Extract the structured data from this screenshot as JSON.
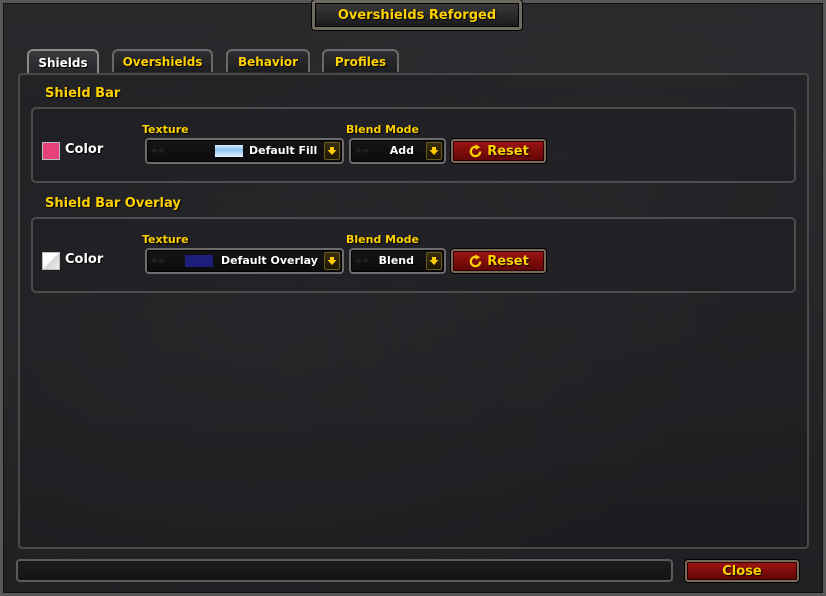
{
  "window": {
    "title": "Overshields Reforged"
  },
  "tabs": [
    {
      "label": "Shields",
      "active": true
    },
    {
      "label": "Overshields",
      "active": false
    },
    {
      "label": "Behavior",
      "active": false
    },
    {
      "label": "Profiles",
      "active": false
    }
  ],
  "sections": [
    {
      "title": "Shield Bar",
      "color_label": "Color",
      "swatch_color": "#e8407a",
      "texture_label": "Texture",
      "texture_value": "Default Fill",
      "texture_preview": "light-blue-gradient",
      "blend_label": "Blend Mode",
      "blend_value": "Add",
      "reset_label": "Reset"
    },
    {
      "title": "Shield Bar Overlay",
      "color_label": "Color",
      "swatch_color": "#f2f2f2",
      "texture_label": "Texture",
      "texture_value": "Default Overlay",
      "texture_preview": "dark-blue",
      "blend_label": "Blend Mode",
      "blend_value": "Blend",
      "reset_label": "Reset"
    }
  ],
  "footer": {
    "close_label": "Close"
  },
  "colors": {
    "accent_gold": "#ffd100",
    "button_red": "#8b0b0b"
  },
  "icons": {
    "reset": "reset-icon",
    "dropdown": "chevron-down-icon"
  }
}
